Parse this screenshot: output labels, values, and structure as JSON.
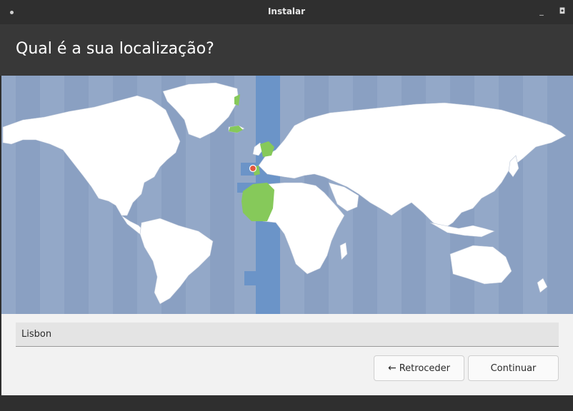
{
  "window": {
    "title": "Instalar",
    "min_glyph": "_",
    "max_glyph": "◘"
  },
  "header": {
    "title": "Qual é a sua localização?"
  },
  "map": {
    "selected_city": "Lisbon",
    "selected_timezone_color": "#6b94c8",
    "selected_region_color": "#86c95a",
    "marker_color": "#e2583e"
  },
  "location": {
    "value": "Lisbon"
  },
  "buttons": {
    "back_label": "Retroceder",
    "back_icon": "←",
    "next_label": "Continuar"
  }
}
